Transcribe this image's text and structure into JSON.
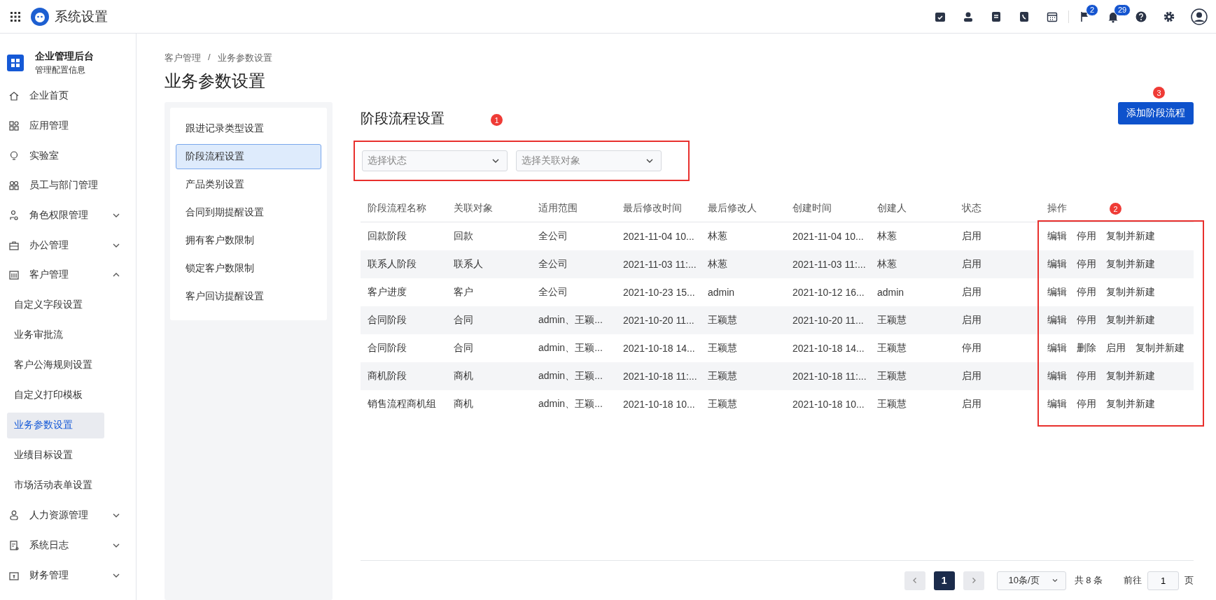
{
  "top_bar": {
    "title": "系统设置",
    "flag_badge": "2",
    "bell_badge": "29"
  },
  "sidebar": {
    "org_name": "企业管理后台",
    "org_subtitle": "管理配置信息",
    "items": [
      {
        "label": "企业首页"
      },
      {
        "label": "应用管理"
      },
      {
        "label": "实验室"
      },
      {
        "label": "员工与部门管理"
      },
      {
        "label": "角色权限管理",
        "expanded": false
      },
      {
        "label": "办公管理",
        "expanded": false
      },
      {
        "label": "客户管理",
        "expanded": true,
        "children": [
          {
            "label": "自定义字段设置",
            "selected": false
          },
          {
            "label": "业务审批流",
            "selected": false
          },
          {
            "label": "客户公海规则设置",
            "selected": false
          },
          {
            "label": "自定义打印模板",
            "selected": false
          },
          {
            "label": "业务参数设置",
            "selected": true
          },
          {
            "label": "业绩目标设置",
            "selected": false
          },
          {
            "label": "市场活动表单设置",
            "selected": false
          }
        ]
      },
      {
        "label": "人力资源管理",
        "expanded": false
      },
      {
        "label": "系统日志",
        "expanded": false
      },
      {
        "label": "财务管理",
        "expanded": false
      }
    ]
  },
  "breadcrumb": {
    "items": [
      "客户管理",
      "业务参数设置"
    ],
    "separator": "/"
  },
  "page_title": "业务参数设置",
  "settings_menu": [
    {
      "label": "跟进记录类型设置",
      "selected": false
    },
    {
      "label": "阶段流程设置",
      "selected": true
    },
    {
      "label": "产品类别设置",
      "selected": false
    },
    {
      "label": "合同到期提醒设置",
      "selected": false
    },
    {
      "label": "拥有客户数限制",
      "selected": false
    },
    {
      "label": "锁定客户数限制",
      "selected": false
    },
    {
      "label": "客户回访提醒设置",
      "selected": false
    }
  ],
  "section_title": "阶段流程设置",
  "add_button": {
    "label": "添加阶段流程",
    "annotation": "3"
  },
  "filters": {
    "annotation": "1",
    "selects": [
      {
        "placeholder": "选择状态"
      },
      {
        "placeholder": "选择关联对象"
      }
    ]
  },
  "table": {
    "actions_annotation": "2",
    "columns": [
      "阶段流程名称",
      "关联对象",
      "适用范围",
      "最后修改时间",
      "最后修改人",
      "创建时间",
      "创建人",
      "状态",
      "操作"
    ],
    "rows": [
      {
        "cells": [
          "回款阶段",
          "回款",
          "全公司",
          "2021-11-04 10...",
          "林葱",
          "2021-11-04 10...",
          "林葱",
          "启用"
        ],
        "actions": [
          "编辑",
          "停用",
          "复制并新建"
        ]
      },
      {
        "cells": [
          "联系人阶段",
          "联系人",
          "全公司",
          "2021-11-03 11:...",
          "林葱",
          "2021-11-03 11:...",
          "林葱",
          "启用"
        ],
        "actions": [
          "编辑",
          "停用",
          "复制并新建"
        ]
      },
      {
        "cells": [
          "客户进度",
          "客户",
          "全公司",
          "2021-10-23 15...",
          "admin",
          "2021-10-12 16...",
          "admin",
          "启用"
        ],
        "actions": [
          "编辑",
          "停用",
          "复制并新建"
        ]
      },
      {
        "cells": [
          "合同阶段",
          "合同",
          "admin、王颖...",
          "2021-10-20 11...",
          "王颖慧",
          "2021-10-20 11...",
          "王颖慧",
          "启用"
        ],
        "actions": [
          "编辑",
          "停用",
          "复制并新建"
        ]
      },
      {
        "cells": [
          "合同阶段",
          "合同",
          "admin、王颖...",
          "2021-10-18 14...",
          "王颖慧",
          "2021-10-18 14...",
          "王颖慧",
          "停用"
        ],
        "actions": [
          "编辑",
          "删除",
          "启用",
          "复制并新建"
        ]
      },
      {
        "cells": [
          "商机阶段",
          "商机",
          "admin、王颖...",
          "2021-10-18 11:...",
          "王颖慧",
          "2021-10-18 11:...",
          "王颖慧",
          "启用"
        ],
        "actions": [
          "编辑",
          "停用",
          "复制并新建"
        ]
      },
      {
        "cells": [
          "销售流程商机组",
          "商机",
          "admin、王颖...",
          "2021-10-18 10...",
          "王颖慧",
          "2021-10-18 10...",
          "王颖慧",
          "启用"
        ],
        "actions": [
          "编辑",
          "停用",
          "复制并新建"
        ]
      }
    ]
  },
  "pagination": {
    "pages": [
      {
        "label": "1",
        "selected": true
      }
    ],
    "page_size": "10条/页",
    "total": "共 8 条",
    "goto_label": "前往",
    "goto_value": "1",
    "goto_unit": "页"
  }
}
